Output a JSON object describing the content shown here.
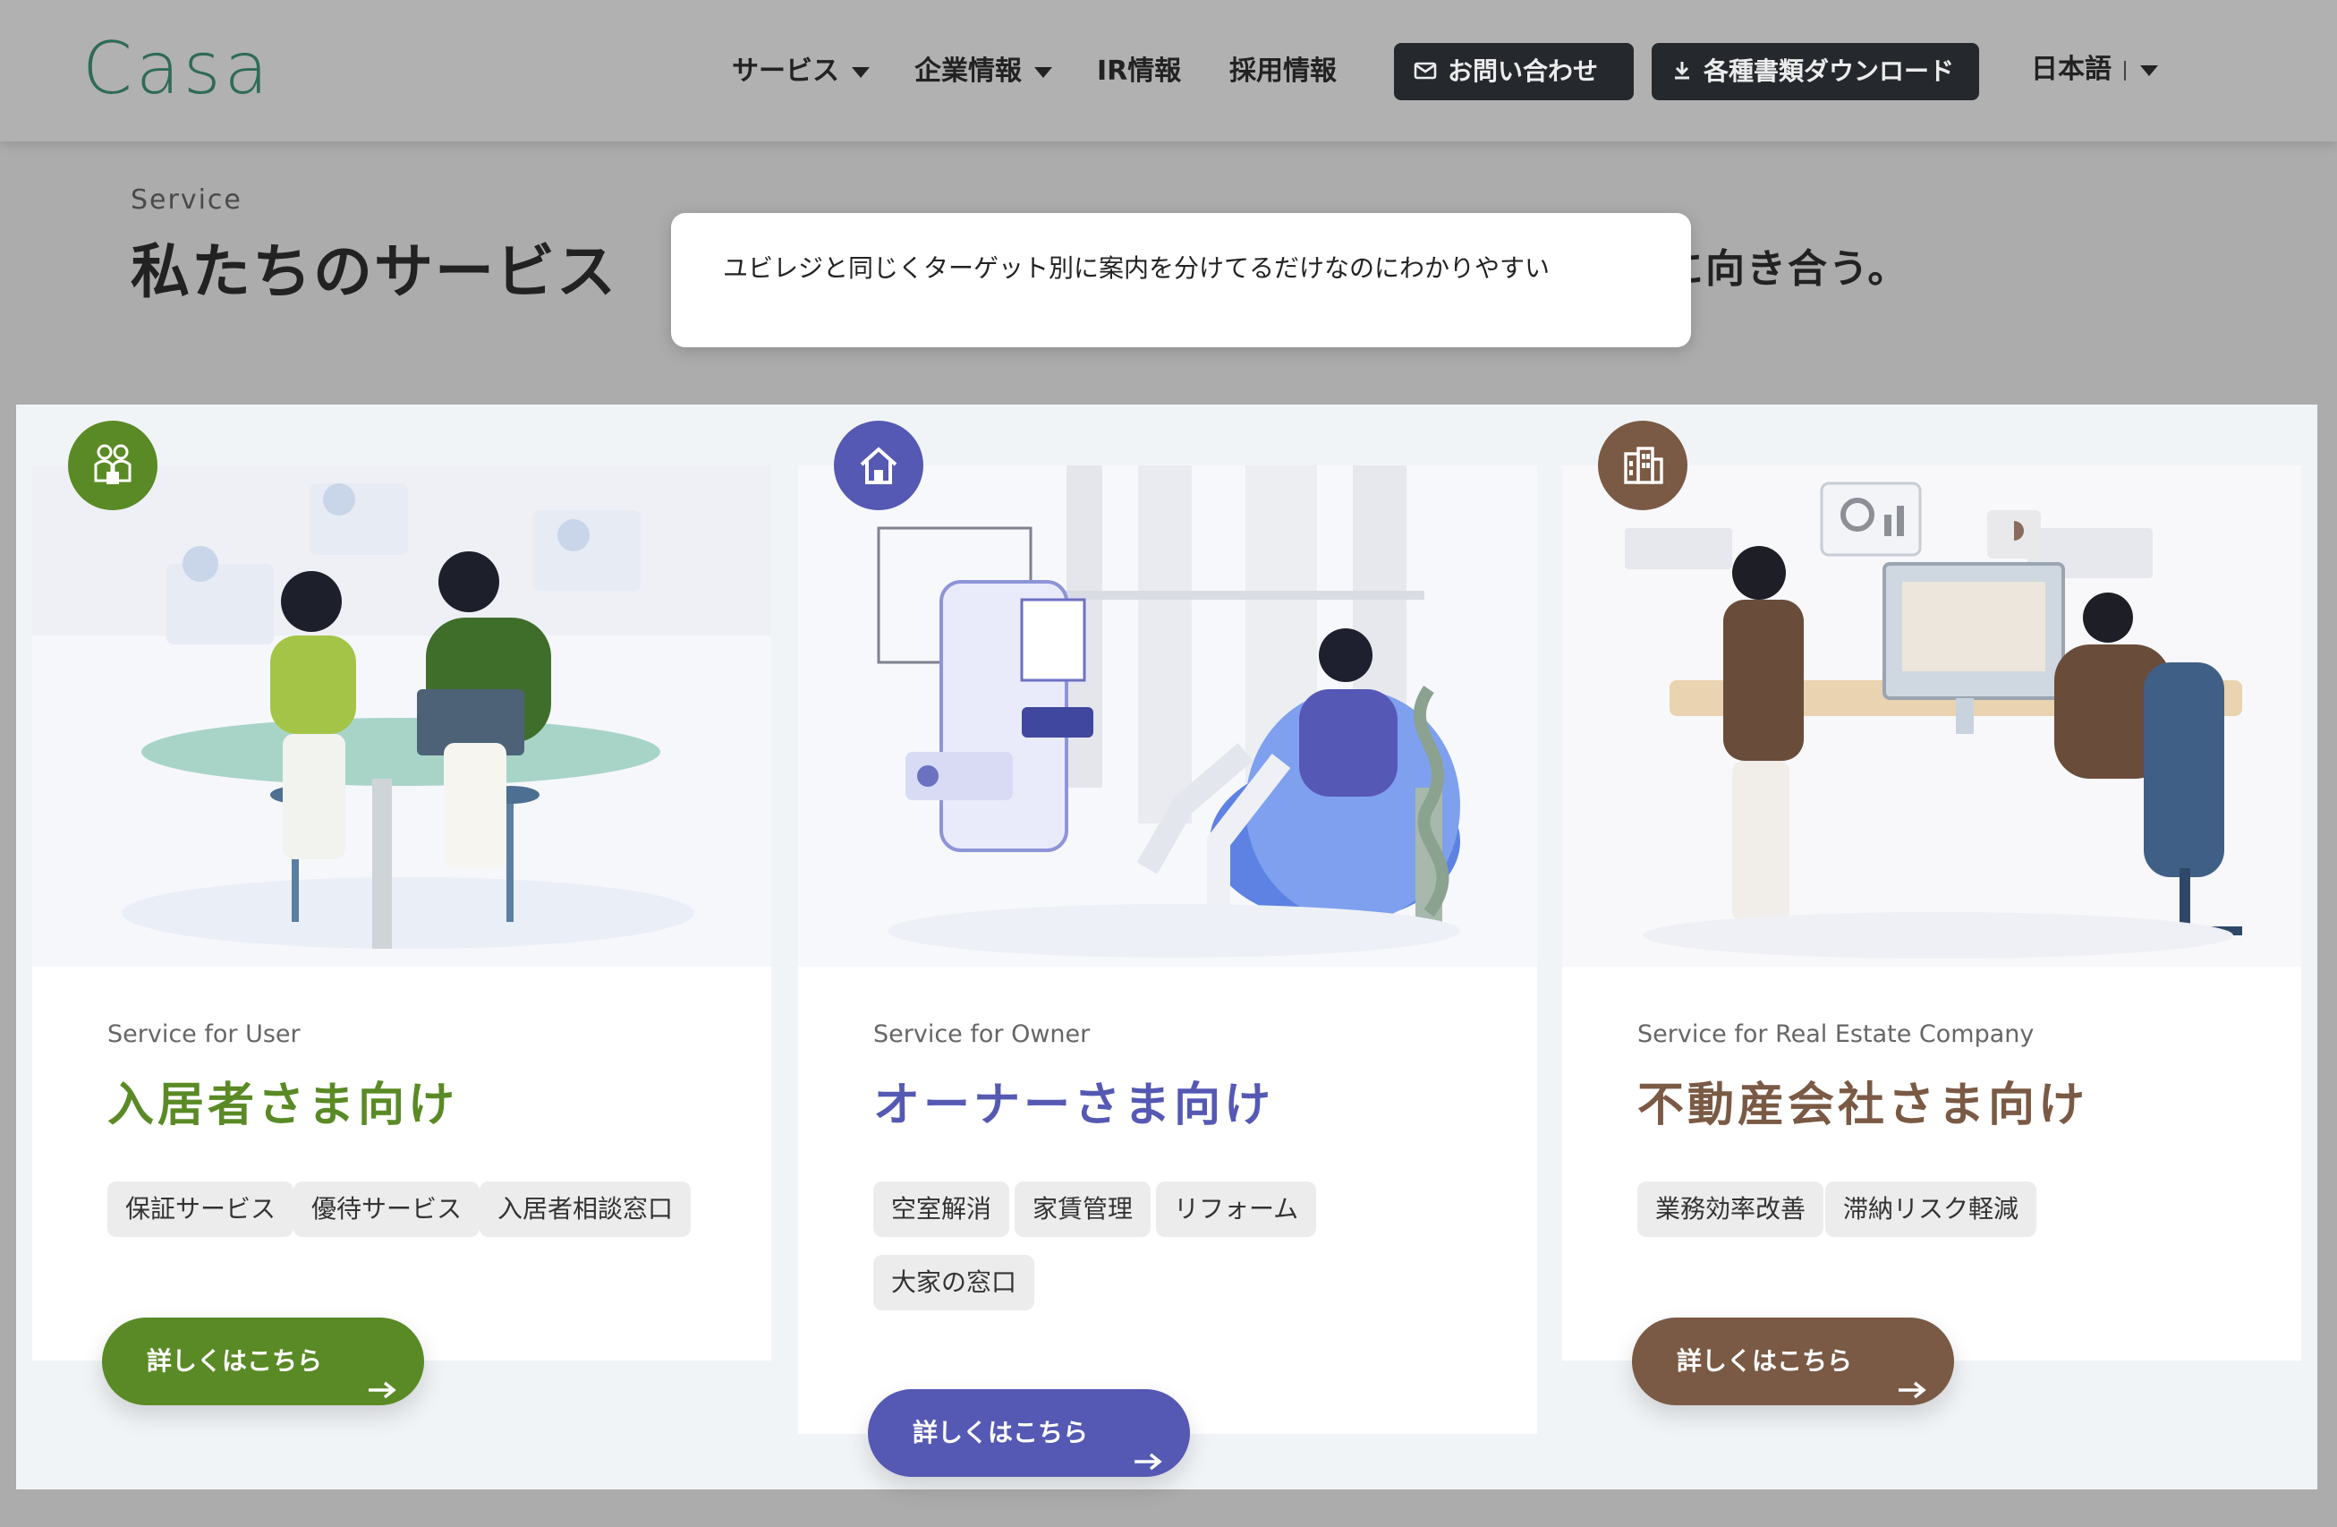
{
  "header": {
    "logo": "Casa",
    "nav": [
      {
        "label": "サービス",
        "dropdown": true
      },
      {
        "label": "企業情報",
        "dropdown": true
      },
      {
        "label": "IR情報",
        "dropdown": false
      },
      {
        "label": "採用情報",
        "dropdown": false
      }
    ],
    "contact_button": {
      "label": "お問い合わせ",
      "icon": "mail-icon"
    },
    "download_button": {
      "label": "各種書類ダウンロード",
      "icon": "download-icon"
    },
    "language": {
      "label": "日本語",
      "icon": "chevron-down-icon"
    }
  },
  "section": {
    "eyebrow": "Service",
    "title": "私たちのサービス",
    "tagline_visible": "に向き合う。"
  },
  "annotation": {
    "text": "ユビレジと同じくターゲット別に案内を分けてるだけなのにわかりやすい"
  },
  "cards": [
    {
      "subtitle": "Service for User",
      "title": "入居者さま向け",
      "accent": "#5a8a25",
      "icon": "family-icon",
      "tags": [
        "保証サービス",
        "優待サービス",
        "入居者相談窓口"
      ],
      "cta": "詳しくはこちら"
    },
    {
      "subtitle": "Service for Owner",
      "title": "オーナーさま向け",
      "accent": "#5559b3",
      "icon": "house-icon",
      "tags": [
        "空室解消",
        "家賃管理",
        "リフォーム",
        "大家の窓口"
      ],
      "cta": "詳しくはこちら"
    },
    {
      "subtitle": "Service for Real Estate Company",
      "title": "不動産会社さま向け",
      "accent": "#7a5a45",
      "icon": "building-icon",
      "tags": [
        "業務効率改善",
        "滞納リスク軽減"
      ],
      "cta": "詳しくはこちら"
    }
  ],
  "colors": {
    "overlay_bg": "#acacac",
    "panel_bg": "#f1f4f7",
    "logo": "#2f6b55",
    "header_button": "#25292e"
  }
}
